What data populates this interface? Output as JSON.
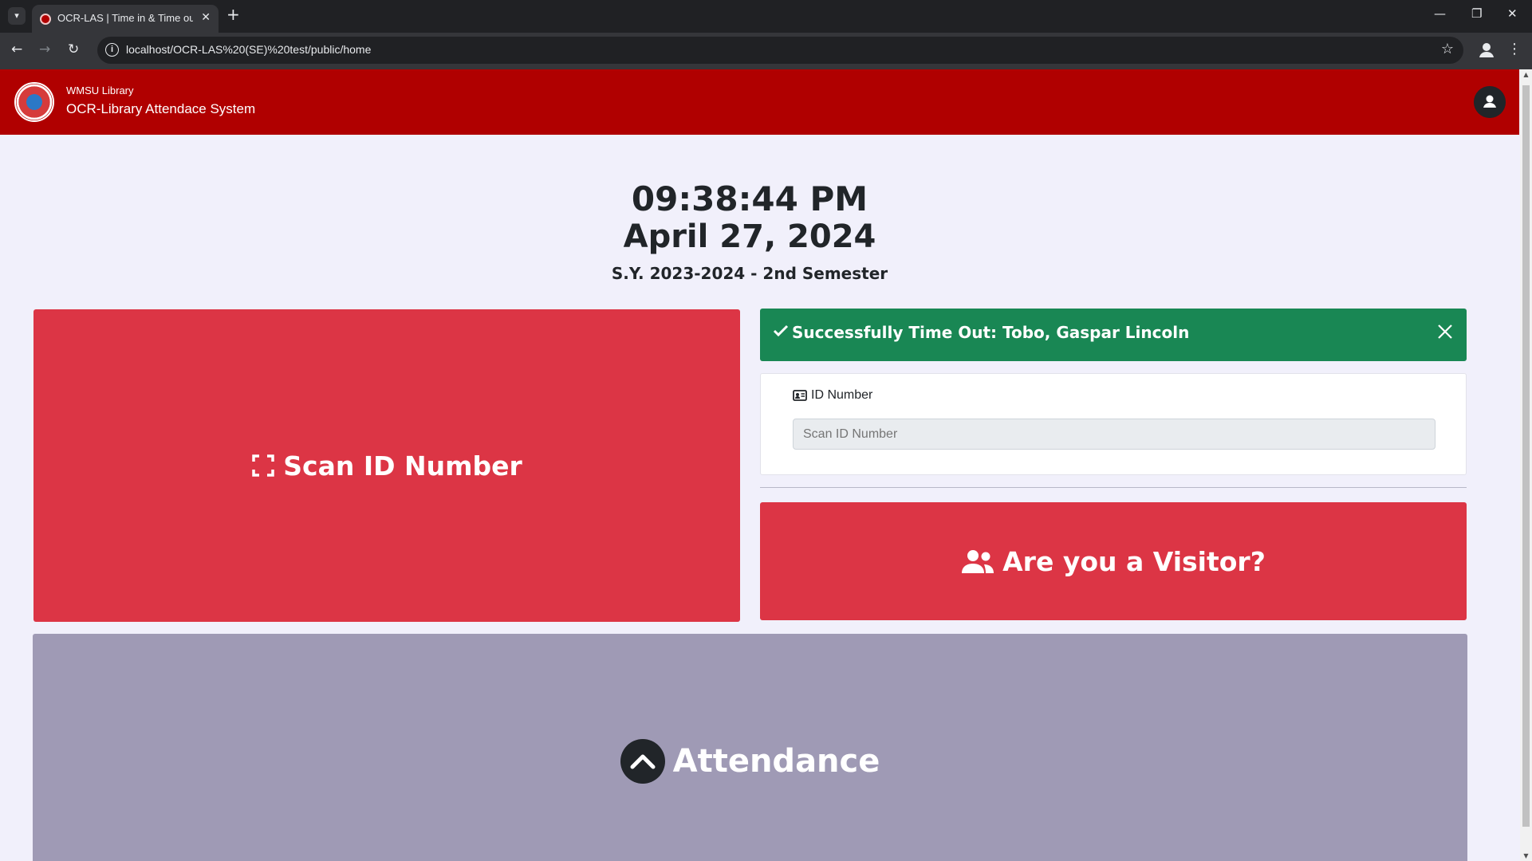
{
  "browser": {
    "tab_title": "OCR-LAS | Time in & Time out",
    "url": "localhost/OCR-LAS%20(SE)%20test/public/home",
    "tab_list_icon": "chevron-down-icon",
    "new_tab_glyph": "+",
    "window_controls": [
      "minimize",
      "restore",
      "close"
    ]
  },
  "header": {
    "brand_subtitle": "WMSU Library",
    "brand_title": "OCR-Library Attendace System",
    "bg_color": "#b00000"
  },
  "clock": {
    "time": "09:38:44 PM",
    "date": "April 27, 2024",
    "school_year": "S.Y. 2023-2024 - 2nd Semester"
  },
  "scan_card": {
    "label": "Scan ID Number",
    "icon": "scan-frame-icon",
    "color": "#dc3545"
  },
  "alert": {
    "message": "Successfully Time Out: Tobo, Gaspar Lincoln",
    "color": "#198754"
  },
  "id_form": {
    "label": "ID Number",
    "placeholder": "Scan ID Number",
    "value": ""
  },
  "visitor_card": {
    "label": "Are you a Visitor?",
    "icon": "users-icon"
  },
  "attendance_card": {
    "label": "Attendance",
    "icon": "chevron-up-circle-icon",
    "color": "#9f9ab5"
  }
}
